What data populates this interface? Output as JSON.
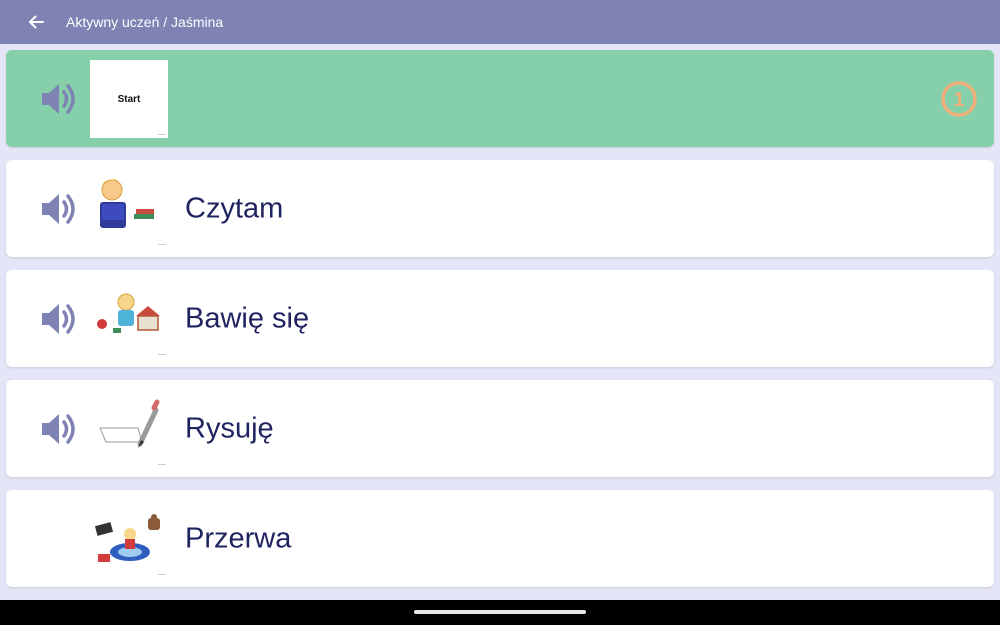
{
  "appbar": {
    "title": "Aktywny uczeń / Jaśmina",
    "back_icon": "arrow-left-icon",
    "color": "#7e83b4"
  },
  "activities": [
    {
      "label": "",
      "thumb_text": "Start",
      "speaker": true,
      "active": true,
      "step": "1",
      "bg": "#85d0aa"
    },
    {
      "label": "Czytam",
      "speaker": true,
      "active": false
    },
    {
      "label": "Bawię się",
      "speaker": true,
      "active": false
    },
    {
      "label": "Rysuję",
      "speaker": true,
      "active": false
    },
    {
      "label": "Przerwa",
      "speaker": false,
      "active": false
    }
  ],
  "colors": {
    "background": "#e4e5f7",
    "speaker_icon": "#7e83b4",
    "step_badge": "#f0ae78",
    "label_text": "#1f2460"
  }
}
